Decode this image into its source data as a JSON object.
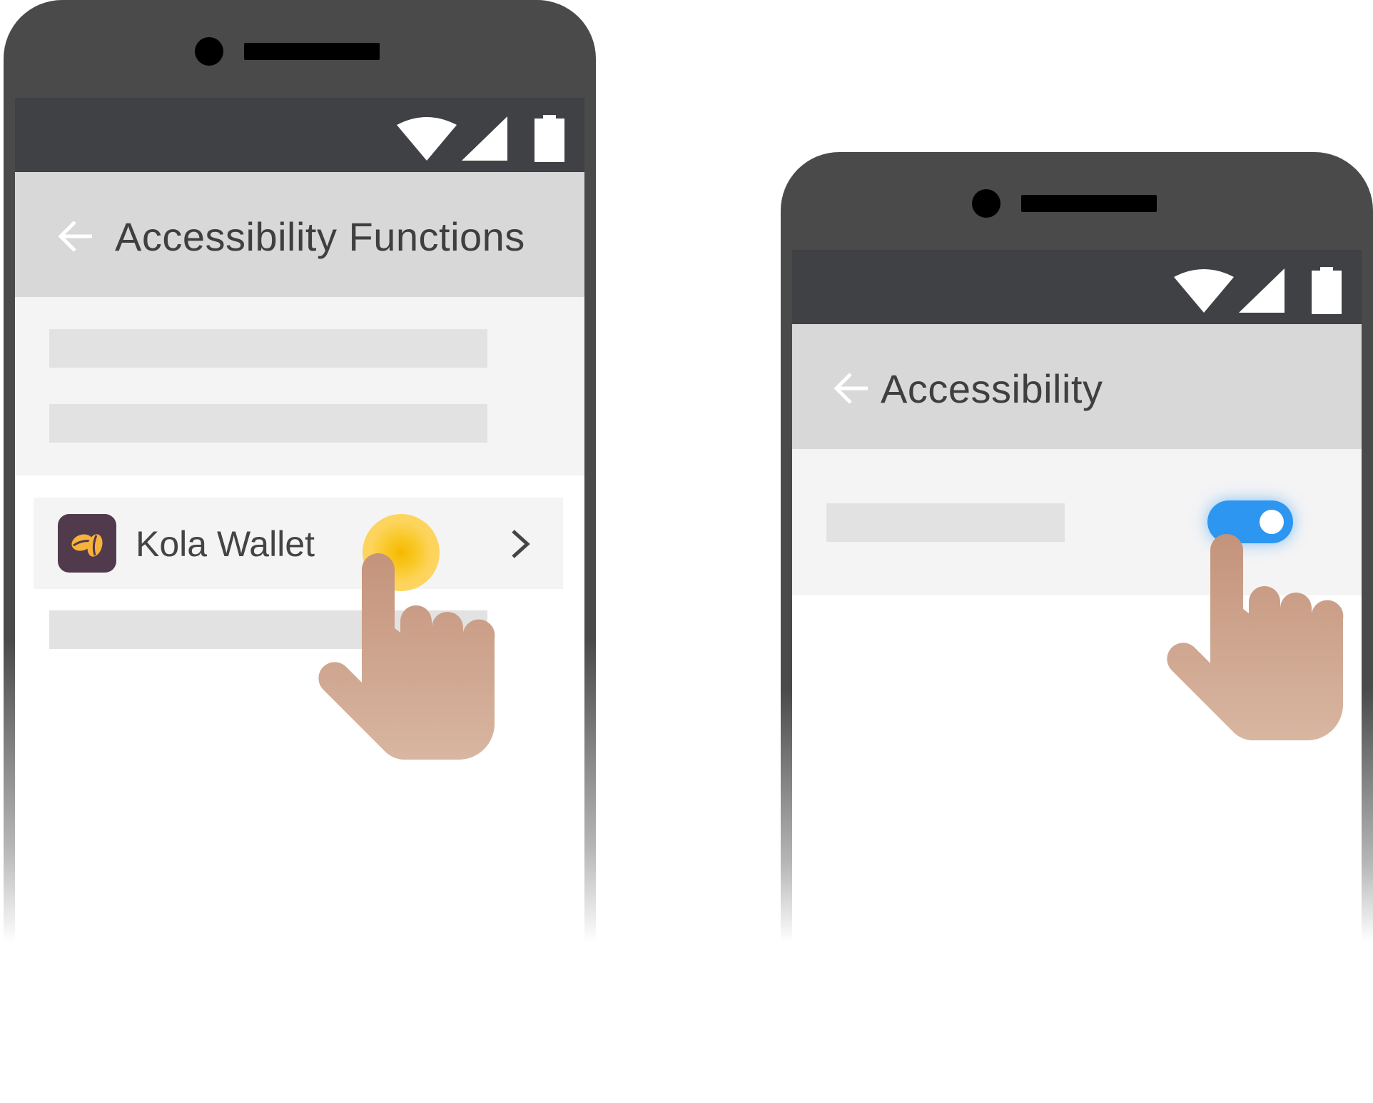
{
  "left_phone": {
    "title": "Accessibility Functions",
    "list_item_label": "Kola Wallet",
    "app_icon": "coffee-bean-icon"
  },
  "right_phone": {
    "title": "Accessibility",
    "toggle_state": "on"
  },
  "colors": {
    "phone_body": "#4a4a4a",
    "status_bar": "#404144",
    "app_bar": "#d8d8d8",
    "toggle_on": "#2c96f0",
    "tap_highlight": "#fdd35a",
    "app_icon_bg": "#523a4d",
    "skin": "#c99a82"
  }
}
